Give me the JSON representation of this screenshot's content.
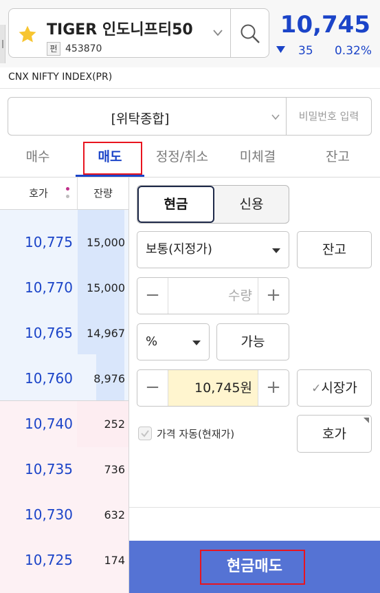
{
  "header": {
    "stock_name": "TIGER 인도니프티50",
    "fund_badge": "펀",
    "stock_code": "453870",
    "price": "10,745",
    "change": "35",
    "change_pct": "0.32%",
    "index_name": "CNX NIFTY INDEX(PR)",
    "icons": {
      "favorite": "star-icon",
      "search": "search-icon",
      "dropdown": "chevron-down-icon",
      "direction": "down-triangle-icon"
    },
    "colors": {
      "price": "#1b44c8",
      "star": "#f7c531"
    }
  },
  "account": {
    "label": "[위탁종합]",
    "password_placeholder": "비밀번호 입력"
  },
  "tabs": [
    {
      "label": "매수",
      "active": false
    },
    {
      "label": "매도",
      "active": true
    },
    {
      "label": "정정/취소",
      "active": false
    },
    {
      "label": "미체결",
      "active": false
    },
    {
      "label": "잔고",
      "active": false
    }
  ],
  "orderbook": {
    "price_header": "호가",
    "qty_header": "잔량",
    "asks": [
      {
        "price": "10,775",
        "qty": "15,000",
        "ratio": 1.0
      },
      {
        "price": "10,770",
        "qty": "15,000",
        "ratio": 1.0
      },
      {
        "price": "10,765",
        "qty": "14,967",
        "ratio": 0.998
      },
      {
        "price": "10,760",
        "qty": "8,976",
        "ratio": 0.6
      }
    ],
    "bids": [
      {
        "price": "10,740",
        "qty": "252"
      },
      {
        "price": "10,735",
        "qty": "736"
      },
      {
        "price": "10,730",
        "qty": "632"
      },
      {
        "price": "10,725",
        "qty": "174"
      }
    ]
  },
  "form": {
    "seg_cash": "현금",
    "seg_credit": "신용",
    "order_type": "보통(지정가)",
    "balance_btn": "잔고",
    "qty_placeholder": "수량",
    "unit": "%",
    "available_btn": "가능",
    "price_value": "10,745원",
    "market_price_btn": "시장가",
    "auto_price_label": "가격 자동(현재가)",
    "quote_btn": "호가",
    "minus": "−",
    "plus": "+",
    "checkmark": "✓"
  },
  "submit": {
    "label": "현금매도",
    "color": "#5573d4"
  }
}
